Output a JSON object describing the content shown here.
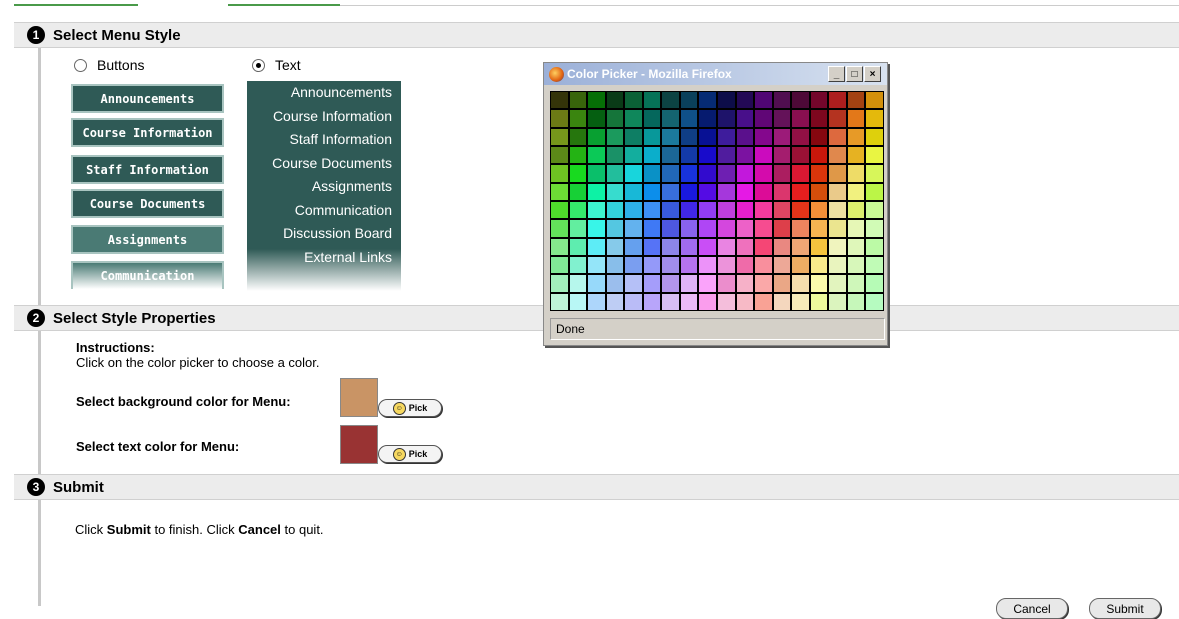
{
  "sections": {
    "step1": {
      "number": "1",
      "title": "Select Menu Style"
    },
    "step2": {
      "number": "2",
      "title": "Select Style Properties"
    },
    "step3": {
      "number": "3",
      "title": "Submit"
    }
  },
  "style_options": {
    "buttons_label": "Buttons",
    "text_label": "Text",
    "selected": "Text"
  },
  "button_menu": [
    "Announcements",
    "Course Information",
    "Staff Information",
    "Course Documents",
    "Assignments",
    "Communication"
  ],
  "text_menu": [
    "Announcements",
    "Course Information",
    "Staff Information",
    "Course Documents",
    "Assignments",
    "Communication",
    "Discussion Board",
    "External Links"
  ],
  "color_picker": {
    "title": "Color Picker - Mozilla Firefox",
    "min_label": "_",
    "max_label": "□",
    "close_label": "×",
    "status": "Done"
  },
  "style_properties": {
    "instructions_heading": "Instructions:",
    "instructions_text": "Click on the color picker to choose a color.",
    "bg_label": "Select background color for Menu:",
    "bg_color": "#c99465",
    "text_label": "Select text color for Menu:",
    "text_color": "#993333",
    "pick_label": "Pick"
  },
  "submit": {
    "text_prefix": "Click ",
    "submit_word": "Submit",
    "text_middle": " to finish. Click ",
    "cancel_word": "Cancel",
    "text_suffix": " to quit.",
    "cancel_label": "Cancel",
    "submit_label": "Submit"
  }
}
